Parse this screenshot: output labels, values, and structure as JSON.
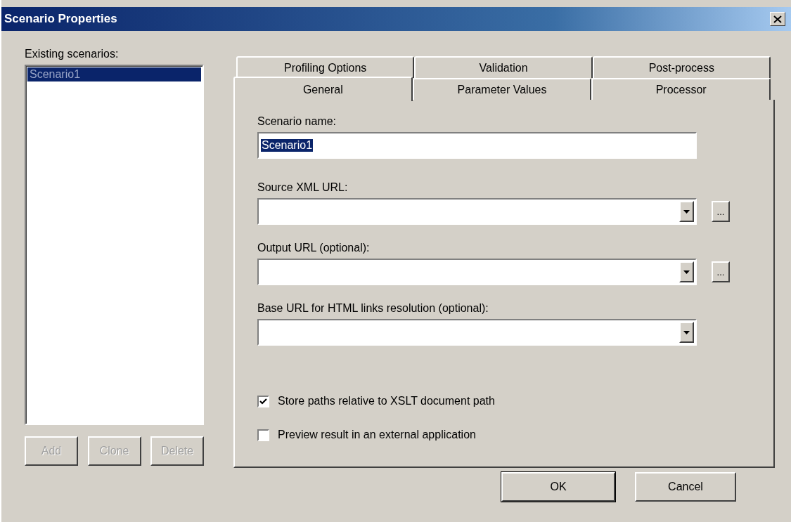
{
  "window": {
    "title": "Scenario Properties"
  },
  "scenarios": {
    "label": "Existing scenarios:",
    "items": [
      {
        "name": "Scenario1",
        "selected": true
      }
    ],
    "buttons": [
      {
        "label": "Add",
        "disabled": true
      },
      {
        "label": "Clone",
        "disabled": true
      },
      {
        "label": "Delete",
        "disabled": true
      }
    ]
  },
  "tab_rows": [
    {
      "tabs": [
        {
          "label": "Profiling Options",
          "selected": false
        },
        {
          "label": "Validation",
          "selected": false
        },
        {
          "label": "Post-process",
          "selected": false
        }
      ]
    },
    {
      "tabs": [
        {
          "label": "General",
          "selected": true
        },
        {
          "label": "Parameter Values",
          "selected": false
        },
        {
          "label": "Processor",
          "selected": false
        }
      ]
    }
  ],
  "fields": [
    {
      "kind": "text",
      "label": "Scenario name:",
      "value": "Scenario1",
      "selected": true
    },
    {
      "kind": "combo",
      "label": "Source XML URL:",
      "browse": "..."
    },
    {
      "kind": "combo",
      "label": "Output URL (optional):",
      "browse": "..."
    },
    {
      "kind": "combo",
      "label": "Base URL for HTML links resolution (optional):"
    }
  ],
  "options": [
    {
      "label": "Store paths relative to XSLT document path",
      "checked": true
    },
    {
      "label": "Preview result in an external application",
      "checked": false
    }
  ],
  "dialog_buttons": [
    {
      "label": "OK",
      "default": true
    },
    {
      "label": "Cancel",
      "default": false
    }
  ]
}
